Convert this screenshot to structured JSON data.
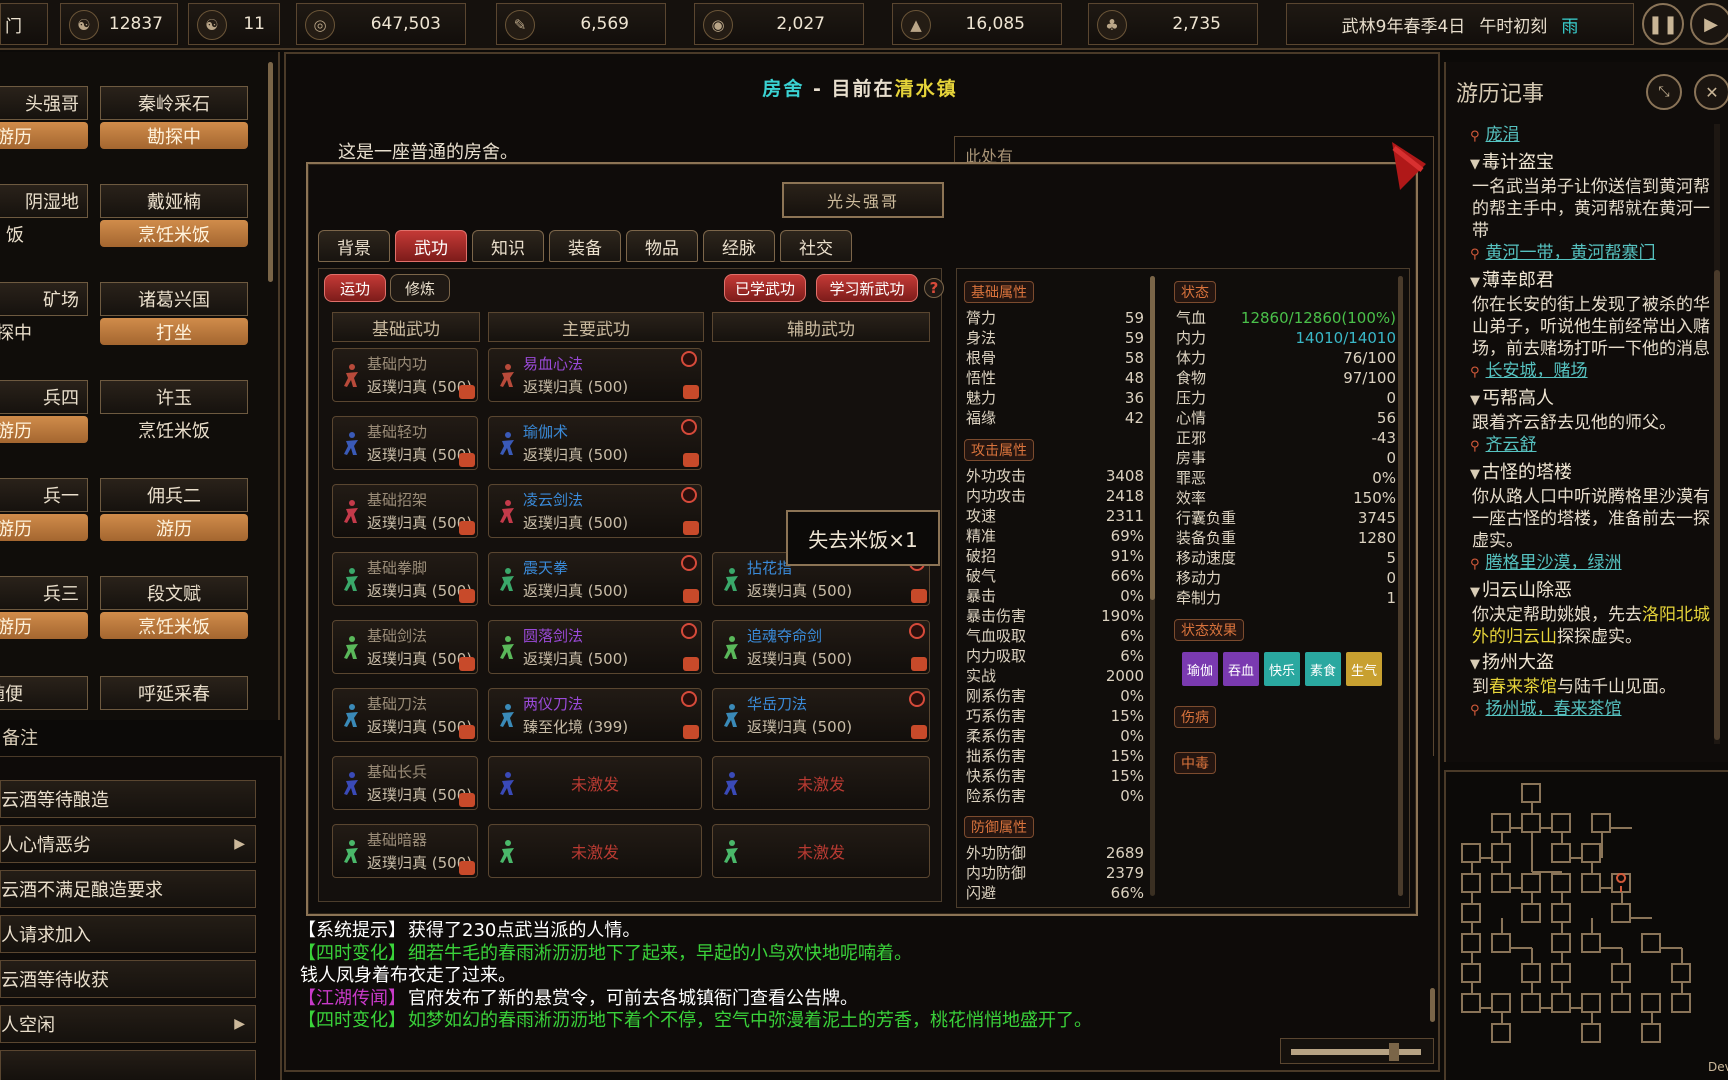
{
  "topbar": {
    "left_edge": "门",
    "resources": [
      {
        "icon": "reputation-icon",
        "glyph": "☯",
        "value": "12837"
      },
      {
        "icon": "yinyang-icon",
        "glyph": "☯",
        "value": "11"
      },
      {
        "icon": "coin-icon",
        "glyph": "◎",
        "value": "647,503"
      },
      {
        "icon": "wood-icon",
        "glyph": "✎",
        "value": "6,569"
      },
      {
        "icon": "food-icon",
        "glyph": "◉",
        "value": "2,027"
      },
      {
        "icon": "stone-icon",
        "glyph": "▲",
        "value": "16,085"
      },
      {
        "icon": "herb-icon",
        "glyph": "♣",
        "value": "2,735"
      }
    ],
    "date": "武林9年春季4日",
    "time": "午时初刻",
    "weather": "雨",
    "pause_icon": "pause-icon",
    "play_icon": "play-icon"
  },
  "npcs": [
    {
      "name": "头强哥",
      "status": "游历",
      "style": "orange"
    },
    {
      "name": "秦岭采石",
      "status": "勘探中",
      "style": "orange"
    },
    {
      "name": "阴湿地",
      "status": "饭",
      "style": "dark"
    },
    {
      "name": "戴娅楠",
      "status": "烹饪米饭",
      "style": "orange"
    },
    {
      "name": "矿场",
      "status": "探中",
      "style": "dark"
    },
    {
      "name": "诸葛兴国",
      "status": "打坐",
      "style": "orange"
    },
    {
      "name": "兵四",
      "status": "游历",
      "style": "orange"
    },
    {
      "name": "许玉",
      "status": "烹饪米饭",
      "style": "dark"
    },
    {
      "name": "兵一",
      "status": "游历",
      "style": "orange"
    },
    {
      "name": "佣兵二",
      "status": "游历",
      "style": "orange"
    },
    {
      "name": "兵三",
      "status": "游历",
      "style": "orange"
    },
    {
      "name": "段文赋",
      "status": "烹饪米饭",
      "style": "orange"
    },
    {
      "name": "随便",
      "status": "",
      "style": "dark"
    },
    {
      "name": "呼延采春",
      "status": "",
      "style": "dark"
    }
  ],
  "notes": {
    "title": "备注",
    "items": [
      {
        "text": "云酒等待酿造",
        "arrow": ""
      },
      {
        "text": "人心情恶劣",
        "arrow": "▶"
      },
      {
        "text": "云酒不满足酿造要求",
        "arrow": ""
      },
      {
        "text": "人请求加入",
        "arrow": ""
      },
      {
        "text": "云酒等待收获",
        "arrow": ""
      },
      {
        "text": "人空闲",
        "arrow": "▶"
      }
    ]
  },
  "room": {
    "title_a": "房舍",
    "title_sep": " - ",
    "title_b": "目前在",
    "town": "清水镇",
    "description": "这是一座普通的房舍。",
    "side_label": "此处有"
  },
  "character": {
    "name": "光头强哥",
    "tabs": [
      "背景",
      "武功",
      "知识",
      "装备",
      "物品",
      "经脉",
      "社交"
    ],
    "active_tab": 1,
    "subtabs": [
      "运功",
      "修炼"
    ],
    "learned_button": "已学武功",
    "learn_new_button": "学习新武功",
    "help_label": "?",
    "columns": [
      "基础武功",
      "主要武功",
      "辅助武功"
    ],
    "basic": [
      {
        "name": "基础内功",
        "level": "返璞归真 (500)",
        "color": "#b84a3a"
      },
      {
        "name": "基础轻功",
        "level": "返璞归真 (500)",
        "color": "#3a5ab8"
      },
      {
        "name": "基础招架",
        "level": "返璞归真 (500)",
        "color": "#c43a4a"
      },
      {
        "name": "基础拳脚",
        "level": "返璞归真 (500)",
        "color": "#3aa86a"
      },
      {
        "name": "基础剑法",
        "level": "返璞归真 (500)",
        "color": "#5ab85a"
      },
      {
        "name": "基础刀法",
        "level": "返璞归真 (500)",
        "color": "#3a8ab8"
      },
      {
        "name": "基础长兵",
        "level": "返璞归真 (500)",
        "color": "#3a4ab8"
      },
      {
        "name": "基础暗器",
        "level": "返璞归真 (500)",
        "color": "#4ab86a"
      }
    ],
    "main": [
      {
        "name": "易血心法",
        "level": "返璞归真 (500)",
        "namecolor": "#9a4ad8"
      },
      {
        "name": "瑜伽术",
        "level": "返璞归真 (500)",
        "namecolor": "#3a8ad8"
      },
      {
        "name": "凌云剑法",
        "level": "返璞归真 (500)",
        "namecolor": "#3a8ad8"
      },
      {
        "name": "震天拳",
        "level": "返璞归真 (500)",
        "namecolor": "#3a8ad8"
      },
      {
        "name": "圆落剑法",
        "level": "返璞归真 (500)",
        "namecolor": "#9a4ad8"
      },
      {
        "name": "两仪刀法",
        "level": "臻至化境 (399)",
        "namecolor": "#9a4ad8"
      },
      {
        "name": "",
        "level": "未激发",
        "namecolor": ""
      },
      {
        "name": "",
        "level": "未激发",
        "namecolor": ""
      }
    ],
    "aux": [
      {
        "name": "拈花指",
        "level": "返璞归真 (500)",
        "namecolor": "#3a8ad8",
        "row": 3
      },
      {
        "name": "追魂夺命剑",
        "level": "返璞归真 (500)",
        "namecolor": "#3a8ad8",
        "row": 4
      },
      {
        "name": "华岳刀法",
        "level": "返璞归真 (500)",
        "namecolor": "#3a8ad8",
        "row": 5
      },
      {
        "name": "",
        "level": "未激发",
        "namecolor": "",
        "row": 6
      },
      {
        "name": "",
        "level": "未激发",
        "namecolor": "",
        "row": 7
      }
    ],
    "tooltip": "失去米饭×1"
  },
  "attributes": {
    "basic_title": "基础属性",
    "basic": [
      {
        "k": "膂力",
        "v": "59"
      },
      {
        "k": "身法",
        "v": "59"
      },
      {
        "k": "根骨",
        "v": "58"
      },
      {
        "k": "悟性",
        "v": "48"
      },
      {
        "k": "魅力",
        "v": "36"
      },
      {
        "k": "福缘",
        "v": "42"
      }
    ],
    "attack_title": "攻击属性",
    "attack": [
      {
        "k": "外功攻击",
        "v": "3408"
      },
      {
        "k": "内功攻击",
        "v": "2418"
      },
      {
        "k": "攻速",
        "v": "2311"
      },
      {
        "k": "精准",
        "v": "69%"
      },
      {
        "k": "破招",
        "v": "91%"
      },
      {
        "k": "破气",
        "v": "66%"
      },
      {
        "k": "暴击",
        "v": "0%"
      },
      {
        "k": "暴击伤害",
        "v": "190%"
      },
      {
        "k": "气血吸取",
        "v": "6%"
      },
      {
        "k": "内力吸取",
        "v": "6%"
      },
      {
        "k": "实战",
        "v": "2000"
      },
      {
        "k": "刚系伤害",
        "v": "0%"
      },
      {
        "k": "巧系伤害",
        "v": "15%"
      },
      {
        "k": "柔系伤害",
        "v": "0%"
      },
      {
        "k": "拙系伤害",
        "v": "15%"
      },
      {
        "k": "快系伤害",
        "v": "15%"
      },
      {
        "k": "险系伤害",
        "v": "0%"
      }
    ],
    "defense_title": "防御属性",
    "defense": [
      {
        "k": "外功防御",
        "v": "2689"
      },
      {
        "k": "内功防御",
        "v": "2379"
      },
      {
        "k": "闪避",
        "v": "66%"
      }
    ],
    "state_title": "状态",
    "state": [
      {
        "k": "气血",
        "v": "12860/12860(100%)",
        "c": "#4ac04a"
      },
      {
        "k": "内力",
        "v": "14010/14010",
        "c": "#3ab8c8"
      },
      {
        "k": "体力",
        "v": "76/100",
        "c": ""
      },
      {
        "k": "食物",
        "v": "97/100",
        "c": ""
      },
      {
        "k": "压力",
        "v": "0",
        "c": ""
      },
      {
        "k": "心情",
        "v": "56",
        "c": ""
      },
      {
        "k": "正邪",
        "v": "-43",
        "c": ""
      },
      {
        "k": "房事",
        "v": "0",
        "c": ""
      },
      {
        "k": "罪恶",
        "v": "0%",
        "c": ""
      },
      {
        "k": "效率",
        "v": "150%",
        "c": ""
      },
      {
        "k": "行囊负重",
        "v": "3745",
        "c": ""
      },
      {
        "k": "装备负重",
        "v": "1280",
        "c": ""
      },
      {
        "k": "移动速度",
        "v": "5",
        "c": ""
      },
      {
        "k": "移动力",
        "v": "0",
        "c": ""
      },
      {
        "k": "牵制力",
        "v": "1",
        "c": ""
      }
    ],
    "effects_title": "状态效果",
    "effects": [
      {
        "t": "瑜伽",
        "c": "#7a3ab0"
      },
      {
        "t": "吞血",
        "c": "#7a3ab0"
      },
      {
        "t": "快乐",
        "c": "#2aa8a0"
      },
      {
        "t": "素食",
        "c": "#2aa8a0"
      },
      {
        "t": "生气",
        "c": "#c8a030"
      }
    ],
    "injury_title": "伤病",
    "poison_title": "中毒"
  },
  "log": [
    {
      "tag": "【系统提示】",
      "tagcolor": "#ffffff",
      "text": "获得了230点武当派的人情。",
      "textcolor": "#ffffff"
    },
    {
      "tag": "【四时变化】",
      "tagcolor": "#3ad23a",
      "text": "细若牛毛的春雨淅沥沥地下了起来，早起的小鸟欢快地呢喃着。",
      "textcolor": "#3ad23a"
    },
    {
      "tag": "",
      "tagcolor": "#ffffff",
      "text": "钱人凤身着布衣走了过来。",
      "textcolor": "#ffffff"
    },
    {
      "tag": "【江湖传闻】",
      "tagcolor": "#c83ac8",
      "text": "官府发布了新的悬赏令，可前去各城镇衙门查看公告牌。",
      "textcolor": "#ffffff"
    },
    {
      "tag": "【四时变化】",
      "tagcolor": "#3ad23a",
      "text": "如梦如幻的春雨淅沥沥地下着个不停，空气中弥漫着泥土的芳香，桃花悄悄地盛开了。",
      "textcolor": "#3ad23a"
    }
  ],
  "journal": {
    "title": "游历记事",
    "top_link": "庞涓",
    "quests": [
      {
        "title": "毒计盗宝",
        "body": "一名武当弟子让你送信到黄河帮的帮主手中，黄河帮就在黄河一带",
        "link": "黄河一带，黄河帮寨门"
      },
      {
        "title": "薄幸郎君",
        "body": "你在长安的街上发现了被杀的华山弟子，听说他生前经常出入赌场，前去赌场打听一下他的消息",
        "link": "长安城，赌场"
      },
      {
        "title": "丐帮高人",
        "body": "跟着齐云舒去见他的师父。",
        "link": "齐云舒"
      },
      {
        "title": "古怪的塔楼",
        "body": "你从路人口中听说腾格里沙漠有一座古怪的塔楼，准备前去一探虚实。",
        "link": "腾格里沙漠，绿洲"
      },
      {
        "title": "归云山除恶",
        "body_a": "你决定帮助姚娘，先去",
        "body_hl": "洛阳北城外的归云山",
        "body_b": "探探虚实。",
        "link": ""
      },
      {
        "title": "扬州大盗",
        "body_a": "到",
        "body_hl": "春来茶馆",
        "body_b": "与陆千山见面。",
        "link": "扬州城，春来茶馆"
      }
    ]
  },
  "minimap_label": "Dev"
}
